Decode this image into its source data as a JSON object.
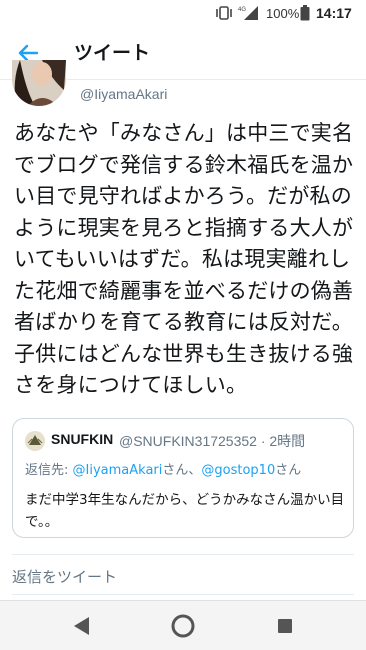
{
  "status_bar": {
    "network": "4G",
    "battery_percent": "100%",
    "time": "14:17"
  },
  "header": {
    "title": "ツイート"
  },
  "tweet": {
    "handle": "@IiyamaAkari",
    "text": "あなたや「みなさん」は中三で実名でブログで発信する鈴木福氏を温かい目で見守ればよかろう。だが私のように現実を見ろと指摘する大人がいてもいいはずだ。私は現実離れした花畑で綺麗事を並べるだけの偽善者ばかりを育てる教育には反対だ。子供にはどんな世界も生き抜ける強さを身につけてほしい。"
  },
  "quote": {
    "name": "SNUFKIN",
    "handle_time": "@SNUFKIN31725352 · 2時間",
    "reply_prefix": "返信先: ",
    "reply_mention_1": "@IiyamaAkari",
    "reply_mid": "さん、",
    "reply_mention_2": "@gostop10",
    "reply_suffix": "さん",
    "text": "まだ中学3年生なんだから、どうかみなさん温かい目で。。"
  },
  "reply_box": {
    "placeholder": "返信をツイート"
  },
  "colors": {
    "accent": "#1da1f2",
    "secondary_text": "#657786",
    "border": "#ccd6dd"
  },
  "icons": {
    "back": "arrow-left-icon",
    "vibrate": "vibrate-icon",
    "signal": "signal-icon",
    "battery": "battery-icon",
    "nav_back": "triangle-back-icon",
    "nav_home": "circle-home-icon",
    "nav_recent": "square-recent-icon"
  }
}
